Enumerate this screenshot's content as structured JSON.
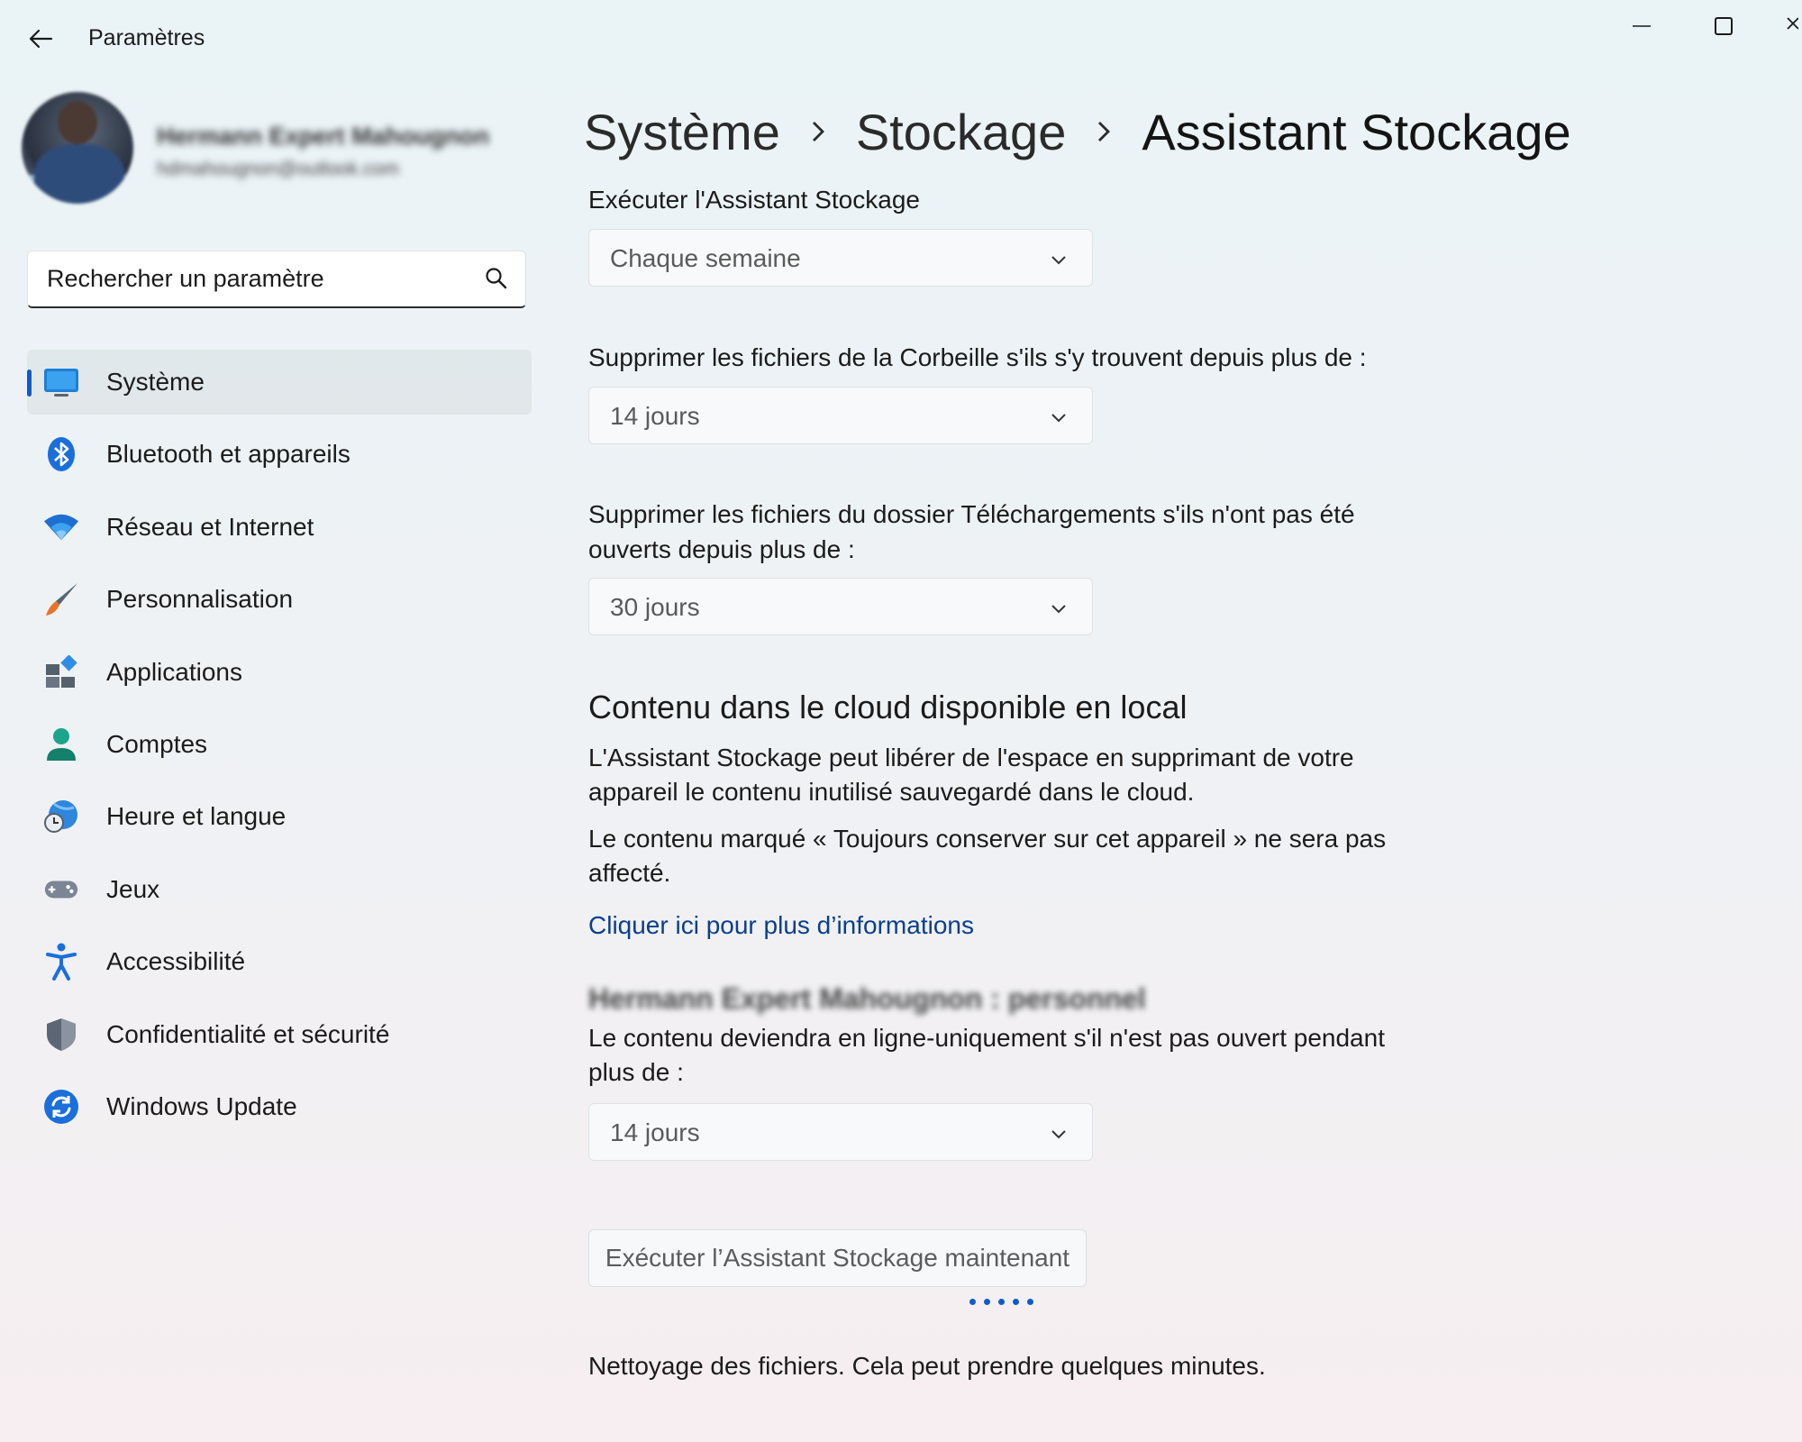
{
  "app": {
    "title": "Paramètres"
  },
  "profile": {
    "name": "Hermann Expert Mahougnon",
    "email": "hdmahougnon@outlook.com"
  },
  "search": {
    "placeholder": "Rechercher un paramètre"
  },
  "sidebar": {
    "items": [
      {
        "label": "Système",
        "icon": "monitor-icon",
        "active": true
      },
      {
        "label": "Bluetooth et appareils",
        "icon": "bluetooth-icon"
      },
      {
        "label": "Réseau et Internet",
        "icon": "wifi-icon"
      },
      {
        "label": "Personnalisation",
        "icon": "paintbrush-icon"
      },
      {
        "label": "Applications",
        "icon": "apps-icon"
      },
      {
        "label": "Comptes",
        "icon": "person-icon"
      },
      {
        "label": "Heure et langue",
        "icon": "globe-clock-icon"
      },
      {
        "label": "Jeux",
        "icon": "gamepad-icon"
      },
      {
        "label": "Accessibilité",
        "icon": "accessibility-icon"
      },
      {
        "label": "Confidentialité et sécurité",
        "icon": "shield-icon"
      },
      {
        "label": "Windows Update",
        "icon": "update-icon"
      }
    ]
  },
  "breadcrumb": {
    "items": [
      "Système",
      "Stockage",
      "Assistant Stockage"
    ]
  },
  "settings": {
    "run_label": "Exécuter l'Assistant Stockage",
    "run_value": "Chaque semaine",
    "recycle_label": "Supprimer les fichiers de la Corbeille s'ils s'y trouvent depuis plus de :",
    "recycle_value": "14 jours",
    "downloads_label": "Supprimer les fichiers du dossier Téléchargements s'ils n'ont pas été ouverts depuis plus de :",
    "downloads_value": "30 jours"
  },
  "cloud": {
    "heading": "Contenu dans le cloud disponible en local",
    "para1": "L'Assistant Stockage peut libérer de l'espace en supprimant de votre appareil le contenu inutilisé sauvegardé dans le cloud.",
    "para2": "Le contenu marqué « Toujours conserver sur cet appareil » ne sera pas affecté.",
    "link": "Cliquer ici pour plus d’informations",
    "account": "Hermann Expert Mahougnon : personnel",
    "online_label": "Le contenu deviendra en ligne-uniquement s'il n'est pas ouvert pendant plus de :",
    "online_value": "14 jours"
  },
  "action": {
    "run_now": "Exécuter l’Assistant Stockage maintenant",
    "status": "Nettoyage des fichiers. Cela peut prendre quelques minutes."
  },
  "colors": {
    "accent": "#0f5cc8",
    "link": "#0b3f8c"
  }
}
